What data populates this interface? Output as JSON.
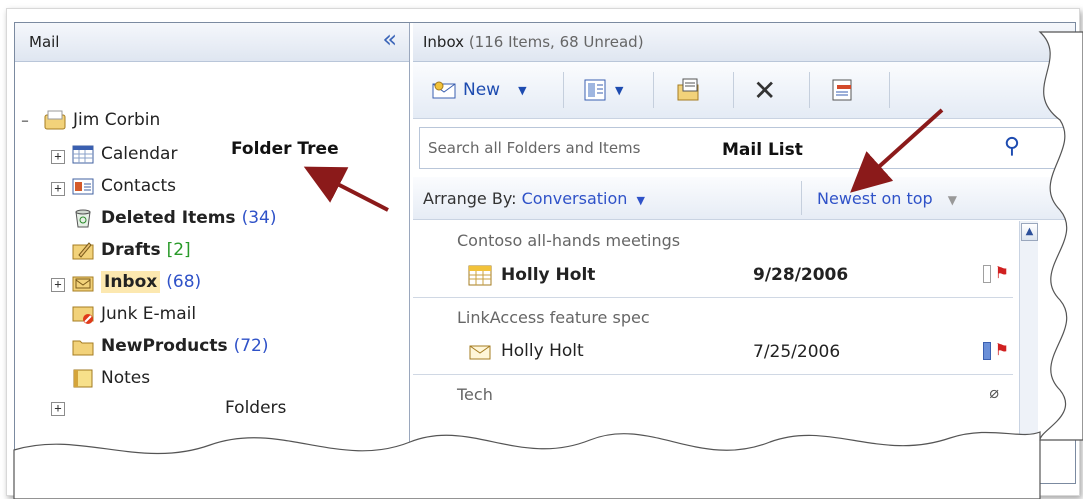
{
  "nav": {
    "title": "Mail",
    "collapse_glyph": "«",
    "account": "Jim Corbin",
    "folders": [
      {
        "label": "Calendar",
        "bold": false
      },
      {
        "label": "Contacts",
        "bold": false
      },
      {
        "label": "Deleted Items",
        "bold": true,
        "count": "(34)"
      },
      {
        "label": "Drafts",
        "bold": true,
        "count": "[2]"
      },
      {
        "label": "Inbox",
        "bold": true,
        "count": "(68)",
        "selected": true
      },
      {
        "label": "Junk E-mail",
        "bold": false
      },
      {
        "label": "NewProducts",
        "bold": true,
        "count": "(72)"
      },
      {
        "label": "Notes",
        "bold": false
      },
      {
        "label": "Folders",
        "bold": false
      }
    ]
  },
  "main": {
    "title": "Inbox",
    "title_sub": "(116 Items, 68 Unread)",
    "toolbar": {
      "new_label": "New"
    },
    "search_placeholder": "Search all Folders and Items",
    "arrange_label": "Arrange By:",
    "arrange_value": "Conversation",
    "sort_label": "Newest on top",
    "conversations": [
      {
        "subject": "Contoso all-hands meetings",
        "sender": "Holly Holt",
        "date": "9/28/2006",
        "bold": true
      },
      {
        "subject": "LinkAccess feature spec",
        "sender": "Holly Holt",
        "date": "7/25/2006",
        "bold": false
      },
      {
        "subject": "Tech",
        "sender": "",
        "date": "",
        "bold": false
      }
    ]
  },
  "callouts": {
    "folder_tree": "Folder Tree",
    "mail_list": "Mail List"
  },
  "colors": {
    "accent": "#2f52c8",
    "arrow": "#8b1a1a",
    "selected_bg": "#fce8b0",
    "flag": "#d02020"
  }
}
